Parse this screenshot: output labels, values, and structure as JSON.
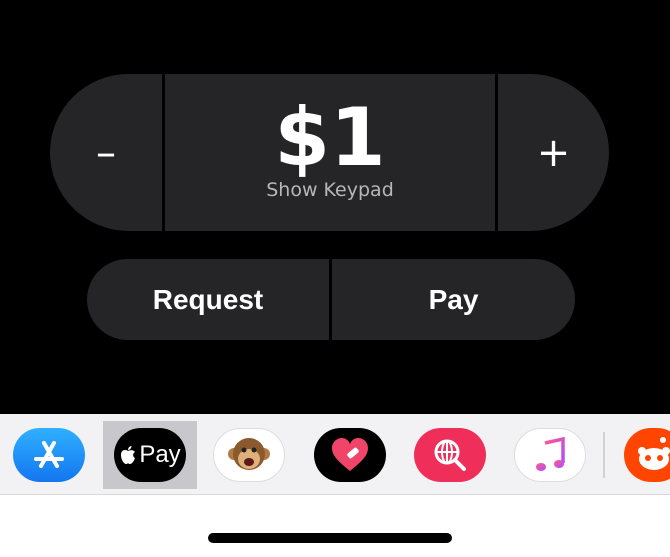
{
  "payment": {
    "minus_label": "–",
    "plus_label": "+",
    "amount": "$1",
    "keypad_link": "Show Keypad",
    "request_label": "Request",
    "pay_label": "Pay"
  },
  "app_tray": {
    "apps": [
      {
        "name": "App Store",
        "icon": "app-store-icon"
      },
      {
        "name": "Apple Pay",
        "icon": "apple-pay-icon",
        "label": "Pay",
        "selected": true
      },
      {
        "name": "Animoji",
        "icon": "monkey-animoji-icon"
      },
      {
        "name": "Digital Touch",
        "icon": "heart-icon"
      },
      {
        "name": "Images",
        "icon": "globe-search-icon"
      },
      {
        "name": "Music",
        "icon": "music-note-icon"
      },
      {
        "name": "Reddit",
        "icon": "reddit-icon"
      }
    ]
  },
  "colors": {
    "background_top": "#000000",
    "button_fill": "#252527",
    "tray_bg": "#f2f2f4"
  }
}
